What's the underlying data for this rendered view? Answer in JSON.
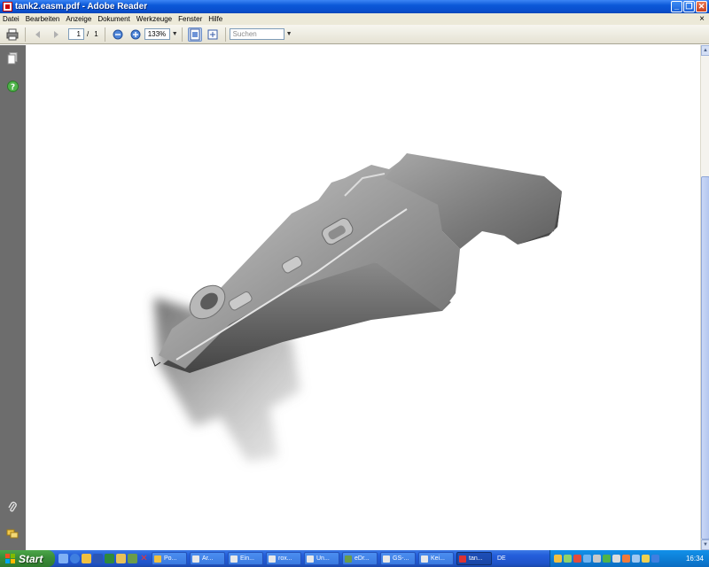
{
  "window": {
    "title": "tank2.easm.pdf - Adobe Reader",
    "controls": [
      "_",
      "❐",
      "✕"
    ]
  },
  "menu": {
    "items": [
      "Datei",
      "Bearbeiten",
      "Anzeige",
      "Dokument",
      "Werkzeuge",
      "Fenster",
      "Hilfe"
    ],
    "close": "×"
  },
  "toolbar": {
    "page_current": "1",
    "page_separator": "/",
    "page_total": "1",
    "zoom": "133%",
    "search_placeholder": "Suchen"
  },
  "taskbar": {
    "start_label": "Start",
    "tasks": [
      "Po...",
      "Ar...",
      "Ein...",
      "rox...",
      "Un...",
      "eDr...",
      "GS-...",
      "Kei...",
      "tan..."
    ],
    "language": "DE",
    "clock": "16:34"
  },
  "colors": {
    "accent": "#0b58d8",
    "start": "#3b8f3a",
    "nav_panel": "#6d6d6d"
  }
}
